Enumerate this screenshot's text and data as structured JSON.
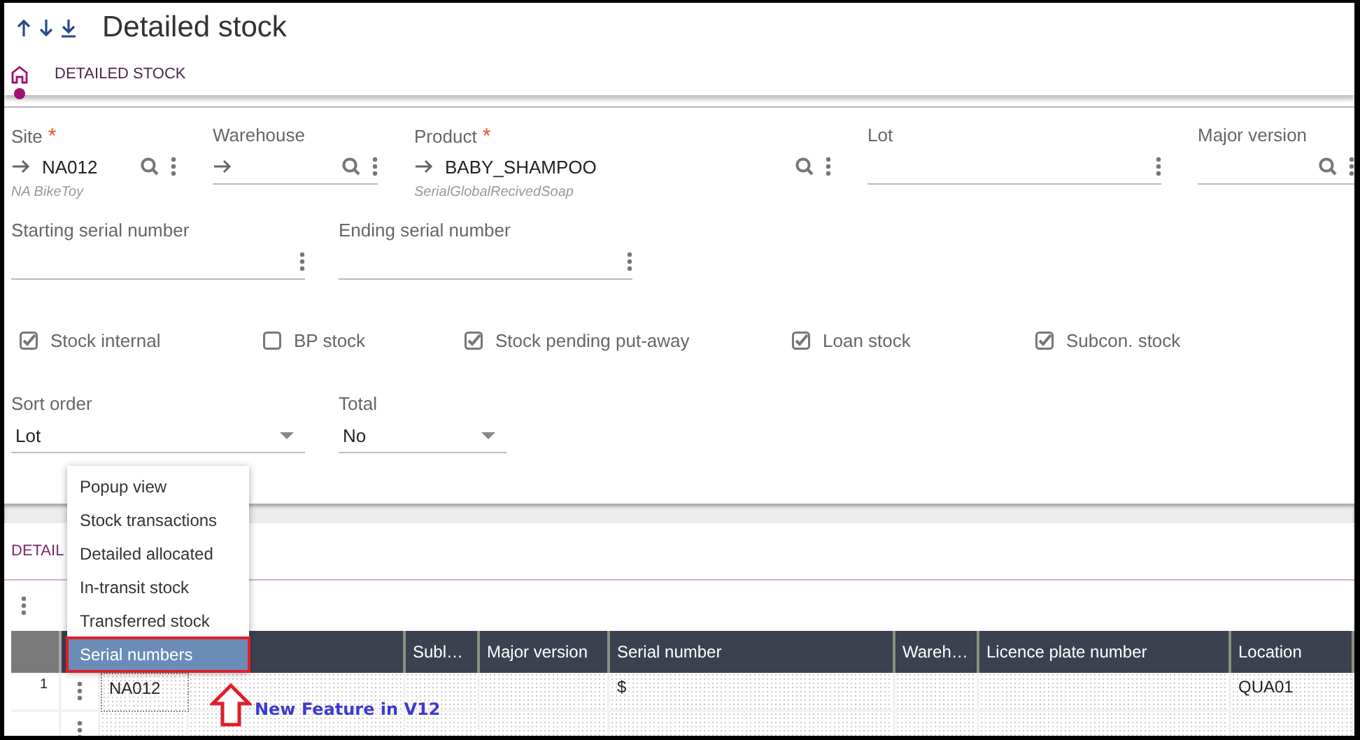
{
  "title": "Detailed stock",
  "breadcrumb": "DETAILED STOCK",
  "fields": [
    {
      "kind": "link",
      "label": "Site",
      "required_mark": "*",
      "value": "NA012",
      "description": "NA BikeToy"
    },
    {
      "kind": "link",
      "label": "Warehouse"
    },
    {
      "kind": "link",
      "label": "Product",
      "required_mark": "*",
      "value": "BABY_SHAMPOO",
      "description": "SerialGlobalRecivedSoap"
    },
    {
      "kind": "text",
      "label": "Lot"
    },
    {
      "kind": "search",
      "label": "Major version"
    }
  ],
  "serial_fields": [
    {
      "label": "Starting serial number"
    },
    {
      "label": "Ending serial number"
    }
  ],
  "checkboxes": [
    {
      "label": "Stock internal",
      "checked": true
    },
    {
      "label": "BP stock",
      "checked": false
    },
    {
      "label": "Stock pending put-away",
      "checked": true
    },
    {
      "label": "Loan stock",
      "checked": true
    },
    {
      "label": "Subcon. stock",
      "checked": true
    }
  ],
  "selects": [
    {
      "label": "Sort order",
      "value": "Lot"
    },
    {
      "label": "Total",
      "value": "No"
    }
  ],
  "detail_title": "DETAIL",
  "table": {
    "columns": [
      null,
      null,
      "Subl…",
      "Major version",
      "Serial number",
      "Wareh…",
      "Licence plate number",
      "Location"
    ],
    "rows": [
      {
        "number": "1",
        "cells": [
          "NA012",
          null,
          null,
          null,
          "$",
          null,
          null,
          "QUA01"
        ]
      }
    ]
  },
  "menu": [
    {
      "label": "Popup view",
      "selected": false,
      "outlined": false
    },
    {
      "label": "Stock transactions",
      "selected": false,
      "outlined": false
    },
    {
      "label": "Detailed allocated",
      "selected": false,
      "outlined": false
    },
    {
      "label": "In-transit stock",
      "selected": false,
      "outlined": false
    },
    {
      "label": "Transferred stock",
      "selected": false,
      "outlined": false
    },
    {
      "label": "Serial numbers",
      "selected": true,
      "outlined": true
    }
  ],
  "annotation": {
    "text": "New Feature in V12"
  }
}
